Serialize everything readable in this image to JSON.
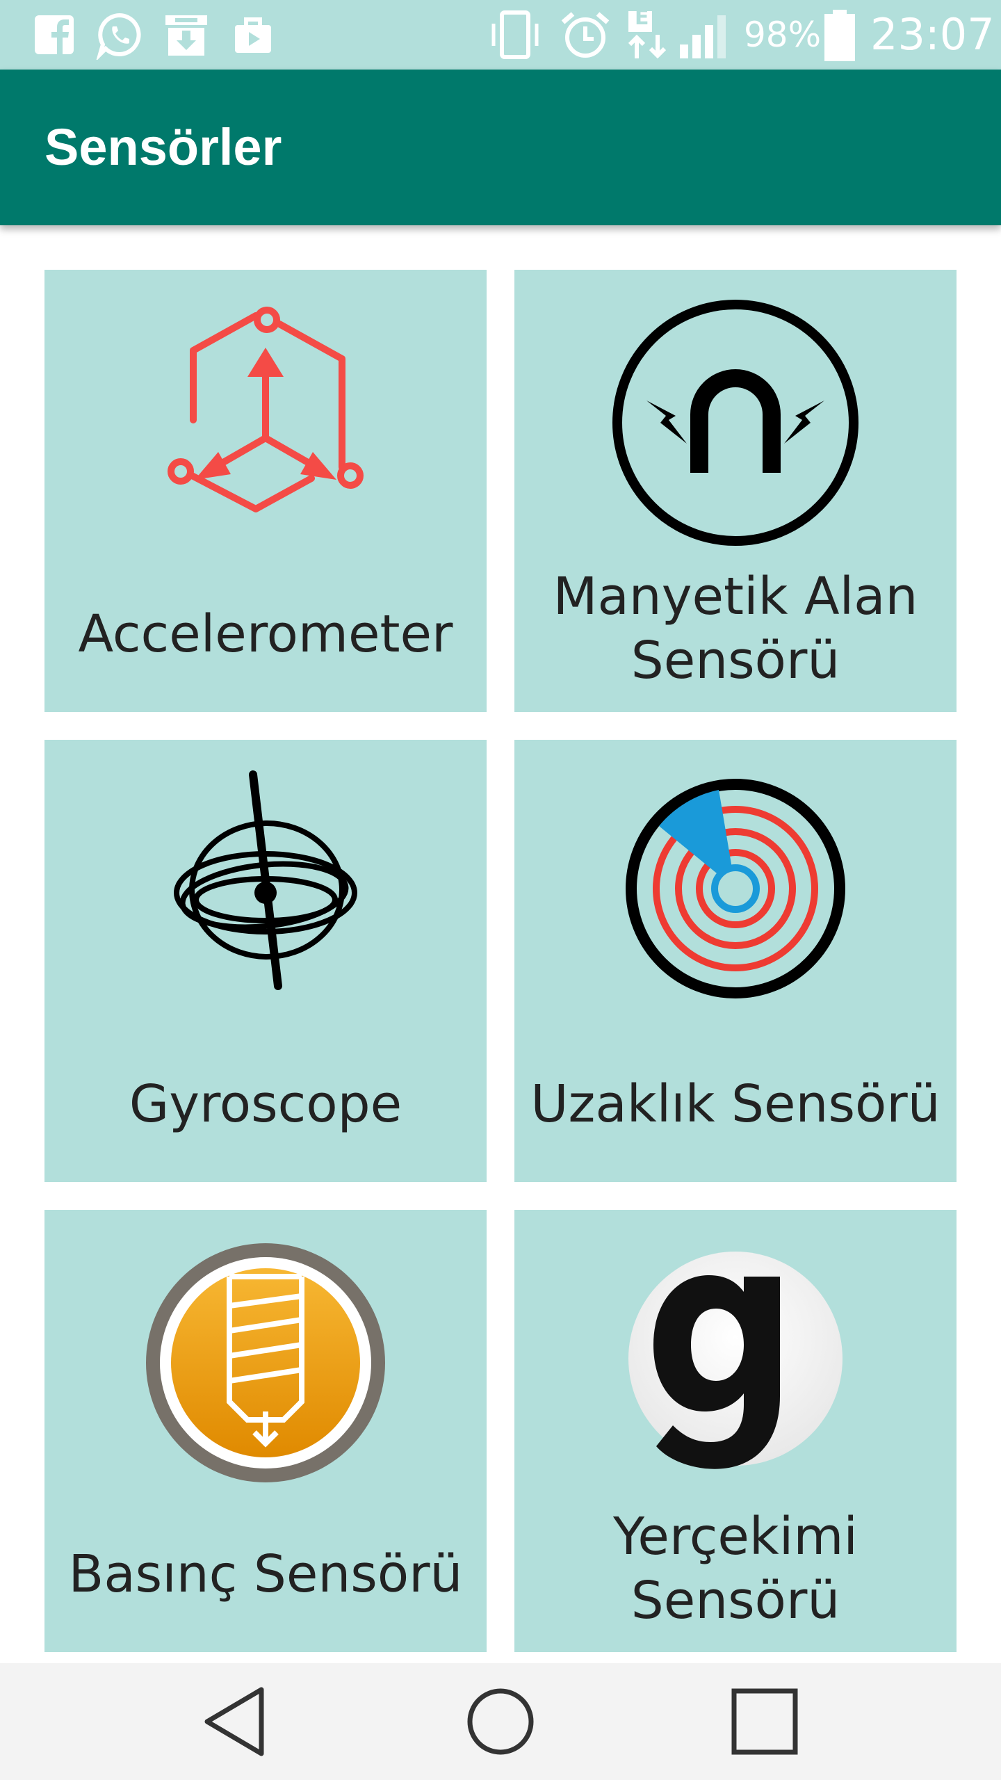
{
  "status_bar": {
    "battery_percent": "98%",
    "time": "23:07",
    "network_type": "E",
    "notification_icons": [
      "facebook-icon",
      "whatsapp-icon",
      "download-box-icon",
      "briefcase-icon"
    ],
    "system_icons": [
      "vibrate-icon",
      "alarm-icon",
      "data-arrows-icon",
      "signal-icon",
      "battery-icon"
    ]
  },
  "app_bar": {
    "title": "Sensörler"
  },
  "sensors": [
    {
      "label": "Accelerometer",
      "icon": "accelerometer-icon"
    },
    {
      "label": "Manyetik Alan Sensörü",
      "icon": "magnet-icon"
    },
    {
      "label": "Gyroscope",
      "icon": "gyroscope-icon"
    },
    {
      "label": "Uzaklık Sensörü",
      "icon": "proximity-radar-icon"
    },
    {
      "label": "Basınç Sensörü",
      "icon": "pressure-icon"
    },
    {
      "label": "Yerçekimi Sensörü",
      "icon": "gravity-g-icon"
    }
  ],
  "colors": {
    "status_bar": "#b2dfdb",
    "app_bar": "#00796b",
    "tile": "#b2dfdb",
    "accent_red": "#f44b46",
    "accent_blue": "#1a9ad9",
    "accent_orange": "#f5a11c"
  },
  "nav_bar": {
    "buttons": [
      "back-icon",
      "home-icon",
      "recents-icon"
    ]
  }
}
